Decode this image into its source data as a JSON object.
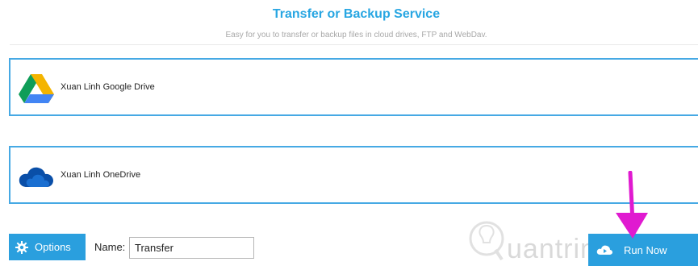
{
  "header": {
    "title": "Transfer or Backup Service",
    "subtitle": "Easy for you to transfer or backup files in cloud drives, FTP and WebDav."
  },
  "services": [
    {
      "label": "Xuan Linh Google Drive",
      "icon": "google-drive-icon"
    },
    {
      "label": "Xuan Linh OneDrive",
      "icon": "onedrive-icon"
    }
  ],
  "footer": {
    "options_label": "Options",
    "name_label": "Name:",
    "name_value": "Transfer",
    "run_label": "Run Now"
  },
  "watermark": {
    "text": "uantrimang"
  },
  "colors": {
    "accent": "#2a9fde",
    "title": "#28a6e2",
    "card_border": "#46a9e4",
    "arrow": "#e01ad0"
  }
}
